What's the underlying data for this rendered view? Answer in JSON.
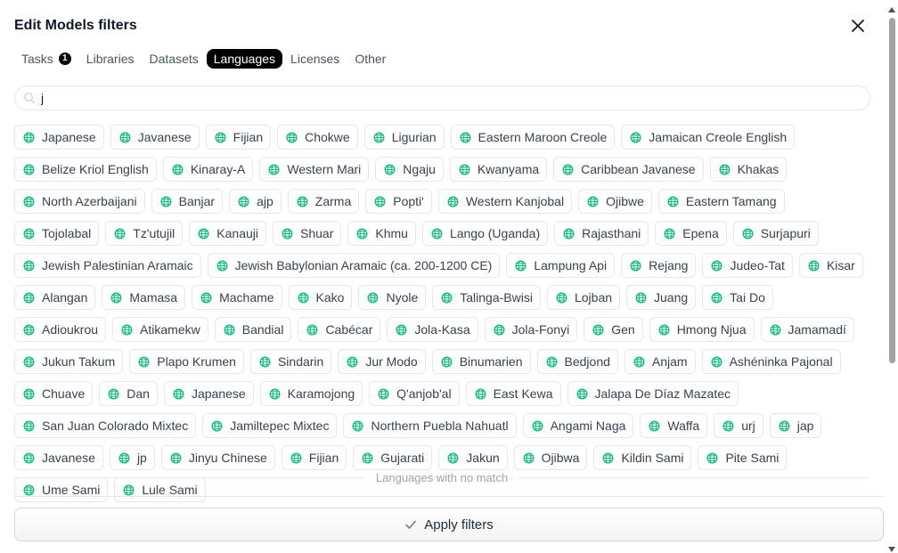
{
  "modal": {
    "title": "Edit Models filters",
    "close_icon": "close-icon"
  },
  "tabs": [
    {
      "label": "Tasks",
      "badge": "1",
      "active": false
    },
    {
      "label": "Libraries",
      "active": false
    },
    {
      "label": "Datasets",
      "active": false
    },
    {
      "label": "Languages",
      "active": true
    },
    {
      "label": "Licenses",
      "active": false
    },
    {
      "label": "Other",
      "active": false
    }
  ],
  "search": {
    "value": "j",
    "placeholder": "",
    "icon": "search-icon"
  },
  "languages": [
    "Japanese",
    "Javanese",
    "Fijian",
    "Chokwe",
    "Ligurian",
    "Eastern Maroon Creole",
    "Jamaican Creole English",
    "Belize Kriol English",
    "Kinaray-A",
    "Western Mari",
    "Ngaju",
    "Kwanyama",
    "Caribbean Javanese",
    "Khakas",
    "North Azerbaijani",
    "Banjar",
    "ajp",
    "Zarma",
    "Popti'",
    "Western Kanjobal",
    "Ojibwe",
    "Eastern Tamang",
    "Tojolabal",
    "Tz'utujil",
    "Kanauji",
    "Shuar",
    "Khmu",
    "Lango (Uganda)",
    "Rajasthani",
    "Epena",
    "Surjapuri",
    "Jewish Palestinian Aramaic",
    "Jewish Babylonian Aramaic (ca. 200-1200 CE)",
    "Lampung Api",
    "Rejang",
    "Judeo-Tat",
    "Kisar",
    "Alangan",
    "Mamasa",
    "Machame",
    "Kako",
    "Nyole",
    "Talinga-Bwisi",
    "Lojban",
    "Juang",
    "Tai Do",
    "Adioukrou",
    "Atikamekw",
    "Bandial",
    "Cabécar",
    "Jola-Kasa",
    "Jola-Fonyi",
    "Gen",
    "Hmong Njua",
    "Jamamadí",
    "Jukun Takum",
    "Plapo Krumen",
    "Sindarin",
    "Jur Modo",
    "Binumarien",
    "Bedjond",
    "Anjam",
    "Ashéninka Pajonal",
    "Chuave",
    "Dan",
    "Japanese",
    "Karamojong",
    "Q'anjob'al",
    "East Kewa",
    "Jalapa De Díaz Mazatec",
    "San Juan Colorado Mixtec",
    "Jamiltepec Mixtec",
    "Northern Puebla Nahuatl",
    "Angami Naga",
    "Waffa",
    "urj",
    "jap",
    "Javanese",
    "jp",
    "Jinyu Chinese",
    "Fijian",
    "Gujarati",
    "Jakun",
    "Ojibwa",
    "Kildin Sami",
    "Pite Sami",
    "Ume Sami",
    "Lule Sami"
  ],
  "language_icon": "globe-icon",
  "no_match_label": "Languages with no match",
  "apply_button": {
    "label": "Apply filters",
    "icon": "check-icon"
  },
  "colors": {
    "globe": "#10b981",
    "active_tab_bg": "#000000"
  }
}
